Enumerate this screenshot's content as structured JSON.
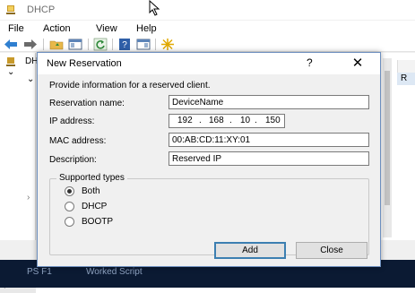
{
  "app": {
    "title": "DHCP",
    "root_node": "DH",
    "right_header": "R"
  },
  "menu": [
    "File",
    "Action",
    "View",
    "Help"
  ],
  "taskbar": {
    "item1": "PS F1",
    "item2": "Worked Script"
  },
  "dialog": {
    "title": "New Reservation",
    "help": "?",
    "close": "✕",
    "description": "Provide information for a reserved client.",
    "fields": {
      "reservation_name_label": "Reservation name:",
      "reservation_name_value": "DeviceName",
      "ip_label": "IP address:",
      "ip_octets": [
        "192",
        "168",
        "10",
        "150"
      ],
      "mac_label": "MAC address:",
      "mac_value": "00:AB:CD:11:XY:01",
      "description_label": "Description:",
      "description_value": "Reserved IP"
    },
    "supported_types": {
      "legend": "Supported types",
      "options": [
        "Both",
        "DHCP",
        "BOOTP"
      ],
      "selected": "Both"
    },
    "buttons": {
      "add": "Add",
      "close": "Close"
    }
  },
  "colors": {
    "accent": "#3c7fb1",
    "taskbar": "#0b1a33"
  }
}
